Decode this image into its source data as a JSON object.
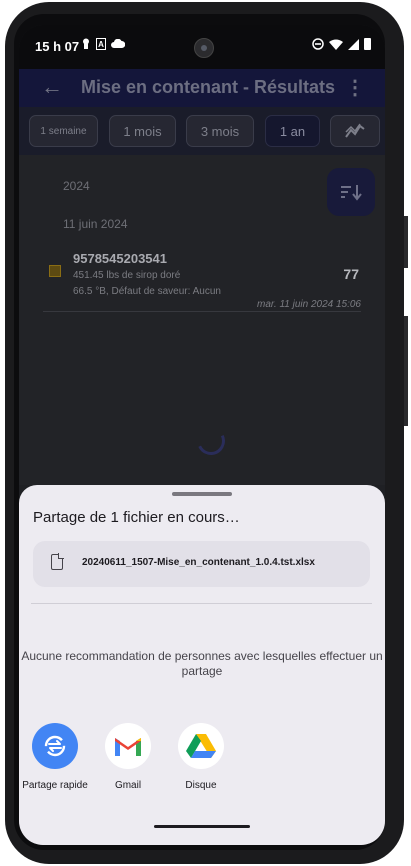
{
  "status_bar": {
    "time": "15 h 07",
    "left_icons": [
      "notification-pin-icon",
      "font-a-icon",
      "cloud-icon"
    ],
    "right_icons": [
      "dnd-icon",
      "wifi-icon",
      "signal-icon",
      "battery-icon"
    ]
  },
  "app_bar": {
    "back_icon": "←",
    "title": "Mise en contenant - Résultats",
    "menu_icon": "⋮"
  },
  "filters": {
    "chips": [
      "1 semaine",
      "1 mois",
      "3 mois",
      "1 an"
    ],
    "selected": "1 an",
    "chart_icon": "chart-icon"
  },
  "results": {
    "year_header": "2024",
    "date_header": "11 juin 2024",
    "sort_icon": "sort-icon",
    "items": [
      {
        "code": "9578545203541",
        "line1": "451.45 lbs de sirop doré",
        "line2": "66.5 °B, Défaut de saveur: Aucun",
        "count": "77",
        "timestamp": "mar. 11 juin 2024 15:06"
      }
    ]
  },
  "share_sheet": {
    "title": "Partage de 1 fichier en cours…",
    "file_name": "20240611_1507-Mise_en_contenant_1.0.4.tst.xlsx",
    "no_recommendation": "Aucune recommandation de personnes avec lesquelles effectuer un partage",
    "targets": [
      {
        "label": "Partage rapide",
        "icon": "quick-share-icon"
      },
      {
        "label": "Gmail",
        "icon": "gmail-icon"
      },
      {
        "label": "Disque",
        "icon": "drive-icon"
      }
    ]
  },
  "colors": {
    "scrim": "#1f2024",
    "app_bar": "#14163a",
    "sheet_bg": "#edebf1",
    "quick_share": "#4285f4",
    "gmail_red": "#ea4335",
    "drive_green": "#34a853",
    "drive_yellow": "#fbbc04"
  }
}
